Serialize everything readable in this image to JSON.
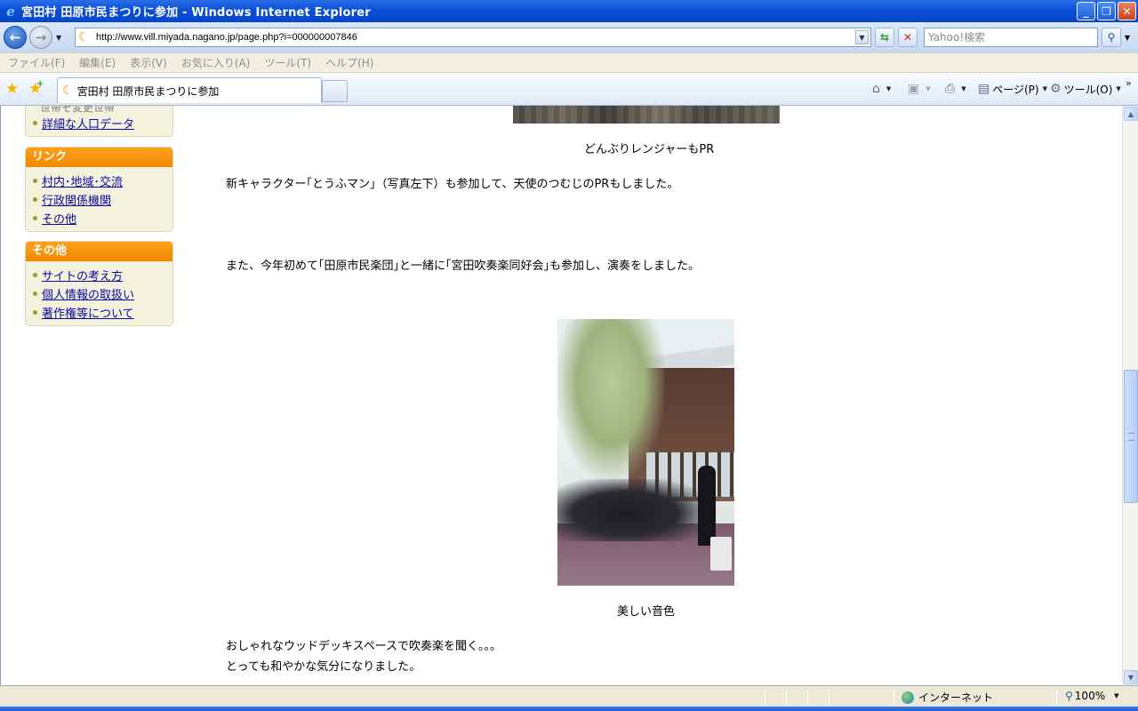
{
  "window": {
    "title": "宮田村 田原市民まつりに参加 - Windows Internet Explorer",
    "buttons": {
      "minimize": "_",
      "restore": "❐",
      "close": "✕"
    }
  },
  "address_bar": {
    "url": "http://www.vill.miyada.nagano.jp/page.php?i=000000007846",
    "search_placeholder": "Yahoo!検索"
  },
  "menu": {
    "items": [
      "ファイル(F)",
      "編集(E)",
      "表示(V)",
      "お気に入り(A)",
      "ツール(T)",
      "ヘルプ(H)"
    ]
  },
  "tabs": {
    "active_label": "宮田村 田原市民まつりに参加"
  },
  "command_bar": {
    "page_label": "ページ(P)",
    "tools_label": "ツール(O)"
  },
  "sidebar": {
    "partial_text": "世帯そ変更世帯",
    "population_link": "詳細な人口データ",
    "links_box": {
      "title": "リンク",
      "items": [
        "村内･地域･交流",
        "行政関係機関",
        "その他"
      ]
    },
    "other_box": {
      "title": "その他",
      "items": [
        "サイトの考え方",
        "個人情報の取扱い",
        "著作権等について"
      ]
    }
  },
  "main": {
    "caption_1": "どんぶりレンジャーもPR",
    "paragraph_1": "新キャラクター｢とうふマン｣（写真左下）も参加して、天使のつむじのPRもしました。",
    "paragraph_2": "また、今年初めて｢田原市民楽団｣と一緒に｢宮田吹奏楽同好会｣も参加し、演奏をしました。",
    "caption_2": "美しい音色",
    "paragraph_3": "おしゃれなウッドデッキスペースで吹奏楽を聞く。。。",
    "paragraph_4": "とっても和やかな気分になりました。"
  },
  "status_bar": {
    "zone": "インターネット",
    "zoom": "100%"
  },
  "colors": {
    "sidebar_header": "#f39800",
    "sidebar_bg": "#f4f1dc",
    "link": "#0a0aa8",
    "titlebar": "#0a4fd8"
  }
}
